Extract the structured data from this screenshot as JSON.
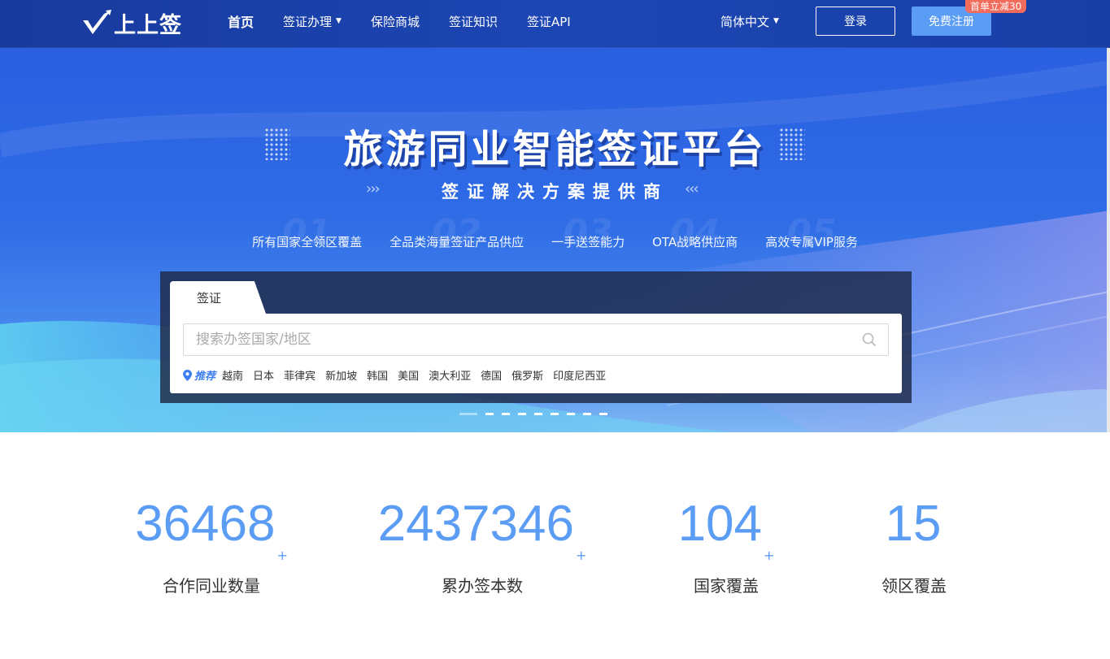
{
  "header": {
    "logo_text": "上上签",
    "nav": [
      {
        "label": "首页",
        "active": true
      },
      {
        "label": "签证办理",
        "dropdown": true
      },
      {
        "label": "保险商城"
      },
      {
        "label": "签证知识"
      },
      {
        "label": "签证API"
      }
    ],
    "language": "简体中文",
    "login_label": "登录",
    "register_label": "免费注册",
    "promo_badge": "首单立减30"
  },
  "hero": {
    "title": "旅游同业智能签证平台",
    "subtitle": "签证解决方案提供商",
    "features": [
      {
        "num": "01",
        "label": "所有国家全领区覆盖"
      },
      {
        "num": "02",
        "label": "全品类海量签证产品供应"
      },
      {
        "num": "03",
        "label": "一手送签能力"
      },
      {
        "num": "04",
        "label": "OTA战略供应商"
      },
      {
        "num": "05",
        "label": "高效专属VIP服务"
      }
    ],
    "slider_count": 9,
    "slider_active": 0
  },
  "search": {
    "tab_label": "签证",
    "placeholder": "搜索办签国家/地区",
    "recommend_label": "推荐",
    "recommend_items": [
      "越南",
      "日本",
      "菲律宾",
      "新加坡",
      "韩国",
      "美国",
      "澳大利亚",
      "德国",
      "俄罗斯",
      "印度尼西亚"
    ]
  },
  "stats": [
    {
      "value": "36468",
      "plus": "+",
      "label": "合作同业数量"
    },
    {
      "value": "2437346",
      "plus": "+",
      "label": "累办签本数"
    },
    {
      "value": "104",
      "plus": "+",
      "label": "国家覆盖"
    },
    {
      "value": "15",
      "plus": "",
      "label": "领区覆盖"
    }
  ],
  "colors": {
    "header_bg": "#1c46b4",
    "accent_blue": "#5b9cf5",
    "promo_red": "#f26b5b",
    "recommend_blue": "#3d7ef0"
  }
}
